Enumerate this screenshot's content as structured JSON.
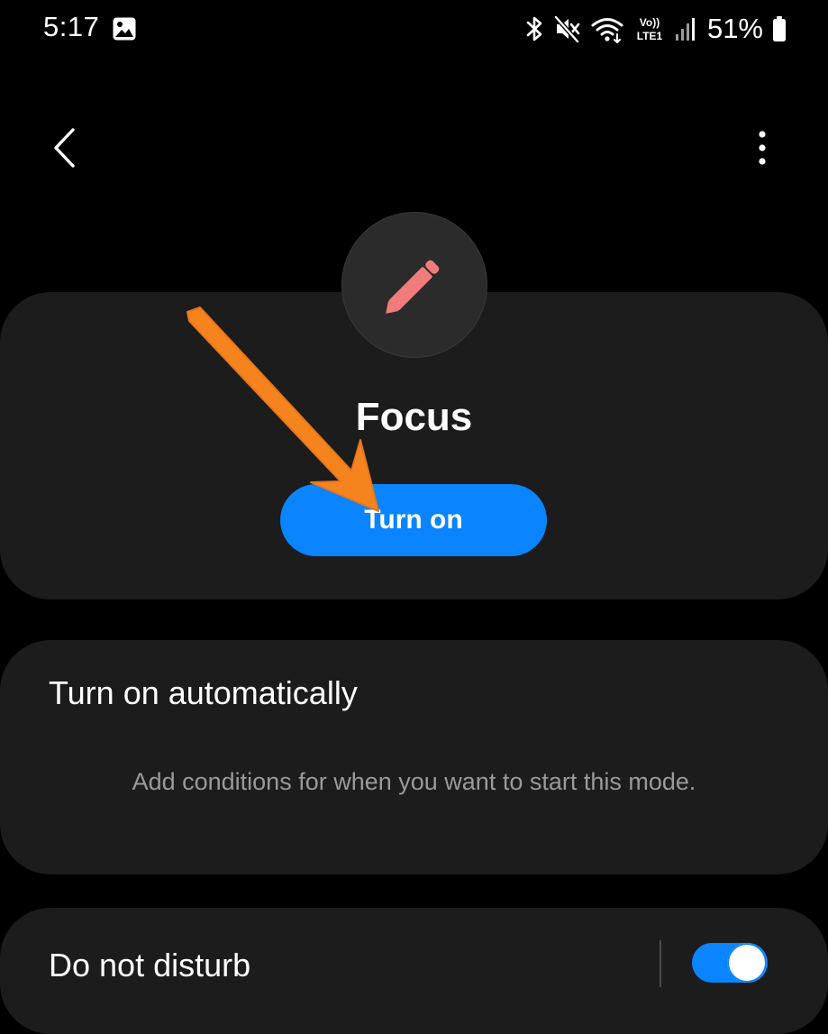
{
  "status_bar": {
    "time": "5:17",
    "network_label": "Vo)) LTE1",
    "battery_percent": "51%",
    "icons": [
      "gallery-icon",
      "bluetooth-icon",
      "mute-icon",
      "wifi-icon",
      "volte-icon",
      "signal-icon",
      "battery-icon"
    ]
  },
  "app_bar": {
    "back_icon": "chevron-left-icon",
    "more_icon": "more-vertical-icon"
  },
  "mode": {
    "icon": "pencil-icon",
    "title": "Focus",
    "turn_on_label": "Turn on"
  },
  "auto_section": {
    "title": "Turn on automatically",
    "description": "Add conditions for when you want to start this mode."
  },
  "dnd_section": {
    "label": "Do not disturb",
    "enabled": true
  },
  "colors": {
    "background": "#000000",
    "card": "#1c1c1c",
    "accent": "#0a84ff",
    "pencil": "#f07c7c",
    "annotation_arrow": "#f5841f",
    "secondary_text": "#9a9a9a"
  }
}
